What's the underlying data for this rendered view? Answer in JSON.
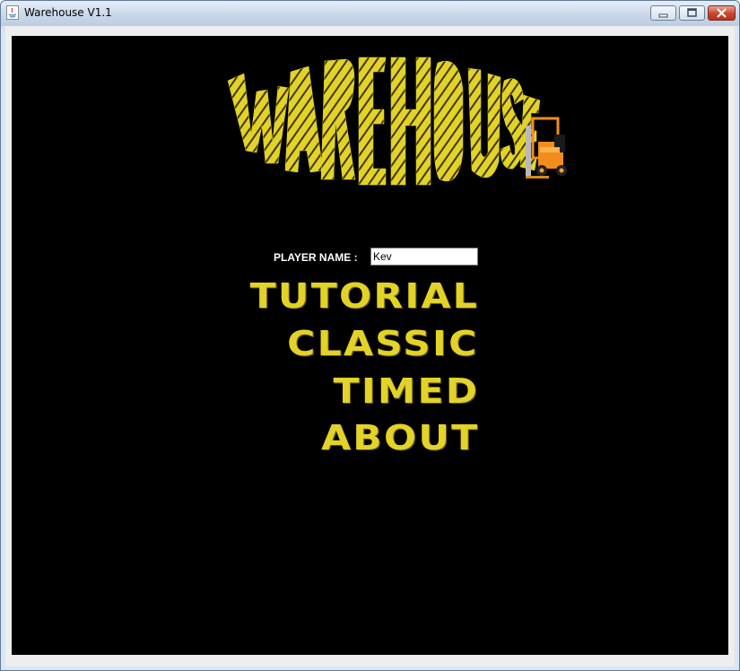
{
  "window": {
    "title": "Warehouse V1.1"
  },
  "logo": {
    "text": "WAREHOUSE",
    "icon": "forklift-icon",
    "fill_color": "#e3d227"
  },
  "player": {
    "label": "PLAYER NAME :",
    "value": "Kev"
  },
  "menu": [
    {
      "label": "TUTORIAL"
    },
    {
      "label": "CLASSIC"
    },
    {
      "label": "TIMED"
    },
    {
      "label": "ABOUT"
    }
  ],
  "colors": {
    "panel_background": "#000000",
    "menu_text": "#e3d227",
    "forklift_orange": "#f28c1e"
  }
}
